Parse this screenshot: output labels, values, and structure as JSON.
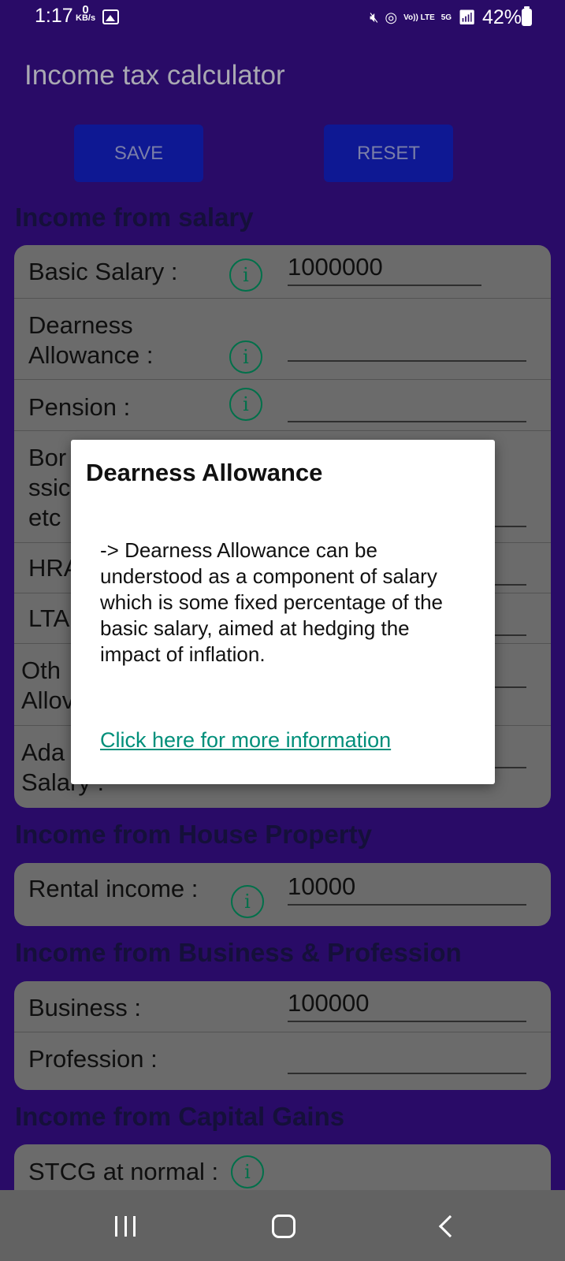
{
  "status_bar": {
    "time": "1:17",
    "net_speed_value": "0",
    "net_speed_unit": "KB/s",
    "volte_label": "Vo)) LTE",
    "network_label": "5G",
    "battery": "42%"
  },
  "app_bar": {
    "title": "Income tax calculator"
  },
  "buttons": {
    "save": "SAVE",
    "reset": "RESET"
  },
  "sections": {
    "salary": {
      "title": "Income from salary",
      "rows": {
        "basic_salary": {
          "label": "Basic Salary :",
          "value": "1000000"
        },
        "dearness": {
          "label": "Dearness Allowance :",
          "value": ""
        },
        "pension": {
          "label": "Pension :",
          "value": ""
        },
        "bonus_partial": {
          "label": "Bor ssic etc"
        },
        "hra_partial": {
          "label": "HRA"
        },
        "lta_partial": {
          "label": "LTA"
        },
        "other_partial": {
          "label": "Oth Allov"
        },
        "additional_partial": {
          "label": "Ada Salary :"
        }
      }
    },
    "house": {
      "title": "Income from House Property",
      "rows": {
        "rental": {
          "label": "Rental income :",
          "value": "10000"
        }
      }
    },
    "business": {
      "title": "Income from Business & Profession",
      "rows": {
        "business": {
          "label": "Business :",
          "value": "100000"
        },
        "profession": {
          "label": "Profession :",
          "value": ""
        }
      }
    },
    "capital": {
      "title": "Income from Capital Gains",
      "rows": {
        "stcg": {
          "label": "STCG at normal :"
        }
      }
    }
  },
  "dialog": {
    "title": "Dearness Allowance",
    "body": "-> Dearness Allowance can be understood as a component of salary which is some fixed percentage of the basic salary, aimed at hedging the impact of inflation.",
    "link": "Click here for more information"
  },
  "icons": {
    "info": "i"
  }
}
